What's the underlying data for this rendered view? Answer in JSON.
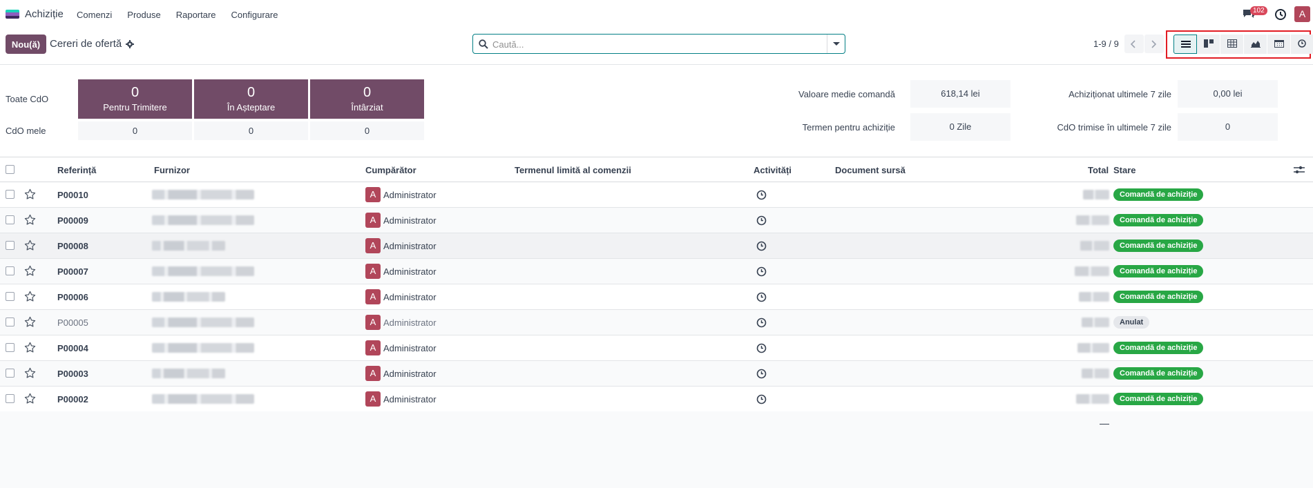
{
  "nav": {
    "app_name": "Achiziție",
    "menu": [
      "Comenzi",
      "Produse",
      "Raportare",
      "Configurare"
    ],
    "chat_count": "102",
    "user_initial": "A",
    "logo_colors": [
      "#1ad3bb",
      "#8c5fbf",
      "#3e2a5f"
    ]
  },
  "control": {
    "new_label": "Nou(ă)",
    "breadcrumb": "Cereri de ofertă",
    "search_placeholder": "Caută...",
    "pager": "1-9 / 9",
    "views": [
      "list-icon",
      "kanban-icon",
      "pivot-icon",
      "graph-icon",
      "calendar-icon",
      "activity-icon"
    ]
  },
  "dashboard": {
    "all_label": "Toate CdO",
    "mine_label": "CdO mele",
    "tiles": [
      {
        "value": "0",
        "label": "Pentru Trimitere"
      },
      {
        "value": "0",
        "label": "În Așteptare"
      },
      {
        "value": "0",
        "label": "Întârziat"
      }
    ],
    "mine_values": [
      "0",
      "0",
      "0"
    ],
    "kpis": [
      {
        "label": "Valoare medie comandă",
        "value": "618,14 lei"
      },
      {
        "label": "Achiziționat ultimele 7 zile",
        "value": "0,00 lei"
      },
      {
        "label": "Termen pentru achiziție",
        "value": "0 Zile"
      },
      {
        "label": "CdO trimise în ultimele 7 zile",
        "value": "0"
      }
    ]
  },
  "table": {
    "columns": {
      "reference": "Referință",
      "vendor": "Furnizor",
      "buyer": "Cumpărător",
      "deadline": "Termenul limită al comenzii",
      "activities": "Activități",
      "source": "Document sursă",
      "total": "Total",
      "status": "Stare"
    },
    "rows": [
      {
        "ref": "P00010",
        "buyer": "Administrator",
        "buyer_initial": "A",
        "status": "Comandă de achiziție",
        "cancelled": false
      },
      {
        "ref": "P00009",
        "buyer": "Administrator",
        "buyer_initial": "A",
        "status": "Comandă de achiziție",
        "cancelled": false
      },
      {
        "ref": "P00008",
        "buyer": "Administrator",
        "buyer_initial": "A",
        "status": "Comandă de achiziție",
        "cancelled": false
      },
      {
        "ref": "P00007",
        "buyer": "Administrator",
        "buyer_initial": "A",
        "status": "Comandă de achiziție",
        "cancelled": false
      },
      {
        "ref": "P00006",
        "buyer": "Administrator",
        "buyer_initial": "A",
        "status": "Comandă de achiziție",
        "cancelled": false
      },
      {
        "ref": "P00005",
        "buyer": "Administrator",
        "buyer_initial": "A",
        "status": "Anulat",
        "cancelled": true
      },
      {
        "ref": "P00004",
        "buyer": "Administrator",
        "buyer_initial": "A",
        "status": "Comandă de achiziție",
        "cancelled": false
      },
      {
        "ref": "P00003",
        "buyer": "Administrator",
        "buyer_initial": "A",
        "status": "Comandă de achiziție",
        "cancelled": false
      },
      {
        "ref": "P00002",
        "buyer": "Administrator",
        "buyer_initial": "A",
        "status": "Comandă de achiziție",
        "cancelled": false
      }
    ]
  },
  "colors": {
    "brand": "#714b67",
    "accent": "#017e84",
    "success": "#28a745",
    "highlight_box": "#e21b23"
  }
}
